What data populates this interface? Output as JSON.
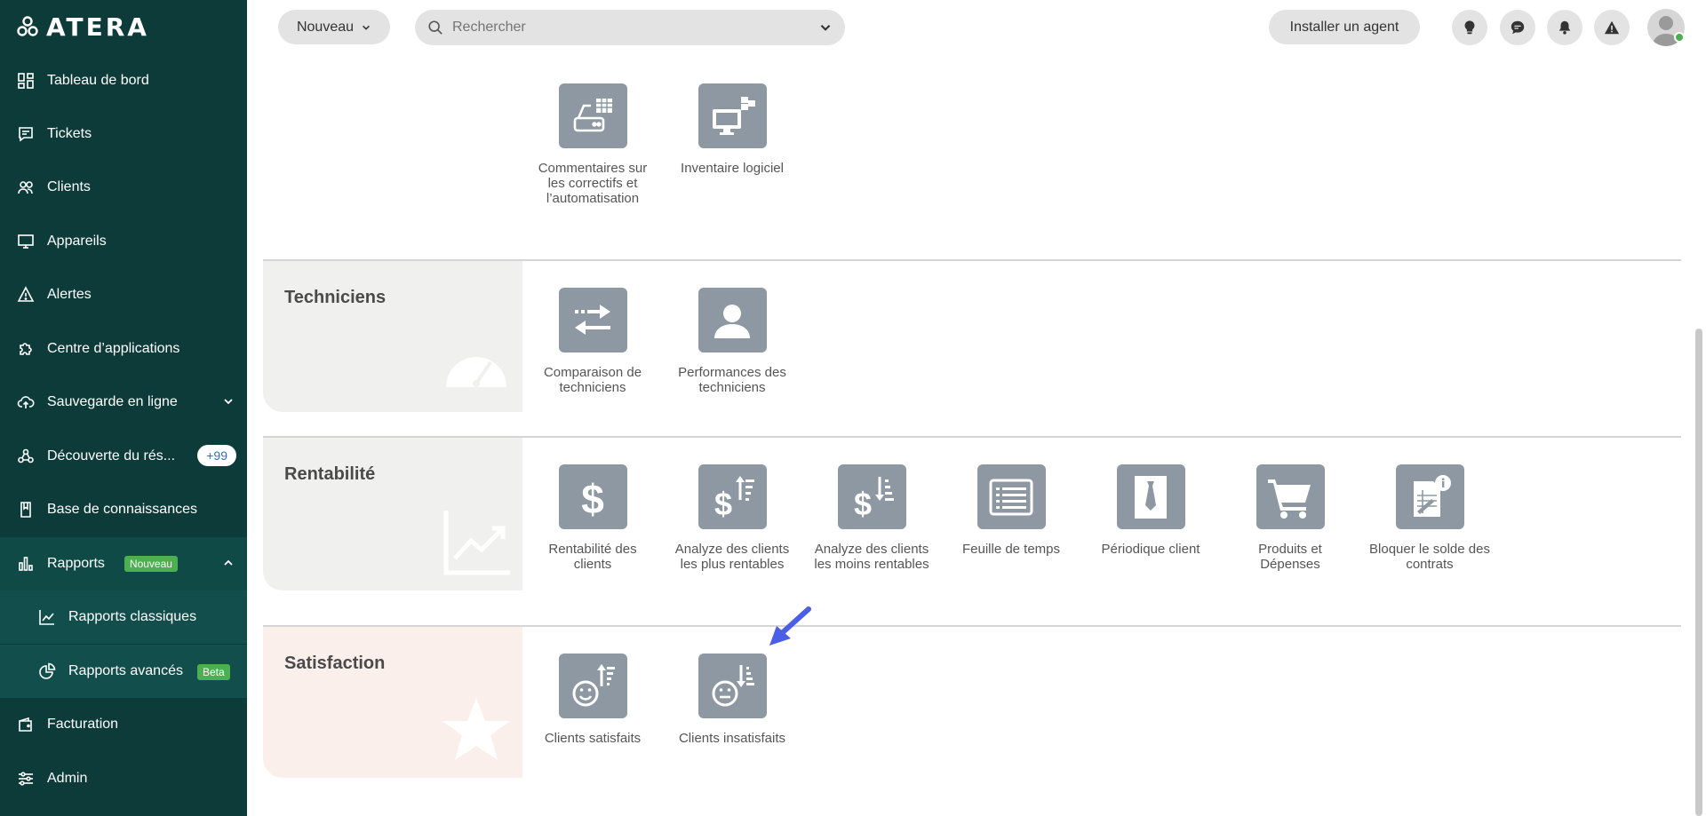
{
  "app": {
    "logo_text": "ATERA"
  },
  "topbar": {
    "new_label": "Nouveau",
    "search_placeholder": "Rechercher",
    "install_agent_label": "Installer un agent"
  },
  "sidebar": {
    "items": [
      {
        "label": "Tableau de bord"
      },
      {
        "label": "Tickets"
      },
      {
        "label": "Clients"
      },
      {
        "label": "Appareils"
      },
      {
        "label": "Alertes"
      },
      {
        "label": "Centre d’applications"
      },
      {
        "label": "Sauvegarde en ligne"
      },
      {
        "label": "Découverte du rés...",
        "badge": "+99"
      },
      {
        "label": "Base de connaissances"
      },
      {
        "label": "Rapports",
        "badge": "Nouveau"
      },
      {
        "label": "Rapports classiques"
      },
      {
        "label": "Rapports avancés",
        "badge": "Beta"
      },
      {
        "label": "Facturation"
      },
      {
        "label": "Admin"
      }
    ]
  },
  "reports": {
    "top_tiles": [
      {
        "label": "Commentaires sur les correctifs et l’automatisation"
      },
      {
        "label": "Inventaire logiciel"
      }
    ],
    "sections": [
      {
        "title": "Techniciens",
        "tiles": [
          {
            "label": "Comparaison de techniciens"
          },
          {
            "label": "Performances des techniciens"
          }
        ]
      },
      {
        "title": "Rentabilité",
        "tiles": [
          {
            "label": "Rentabilité des clients"
          },
          {
            "label": "Analyze des clients les plus rentables"
          },
          {
            "label": "Analyze des clients les moins rentables"
          },
          {
            "label": "Feuille de temps"
          },
          {
            "label": "Périodique client"
          },
          {
            "label": "Produits et Dépenses"
          },
          {
            "label": "Bloquer le solde des contrats"
          }
        ]
      },
      {
        "title": "Satisfaction",
        "tiles": [
          {
            "label": "Clients satisfaits"
          },
          {
            "label": "Clients insatisfaits"
          }
        ]
      }
    ]
  },
  "colors": {
    "sidebar_bg": "#0c3b39",
    "tile_bg": "#8d98a3",
    "section_head_neutral": "#f0f0ee",
    "section_head_satisfaction": "#fbefec",
    "badge_green": "#4caf50",
    "arrow_blue": "#4a5ee8"
  }
}
